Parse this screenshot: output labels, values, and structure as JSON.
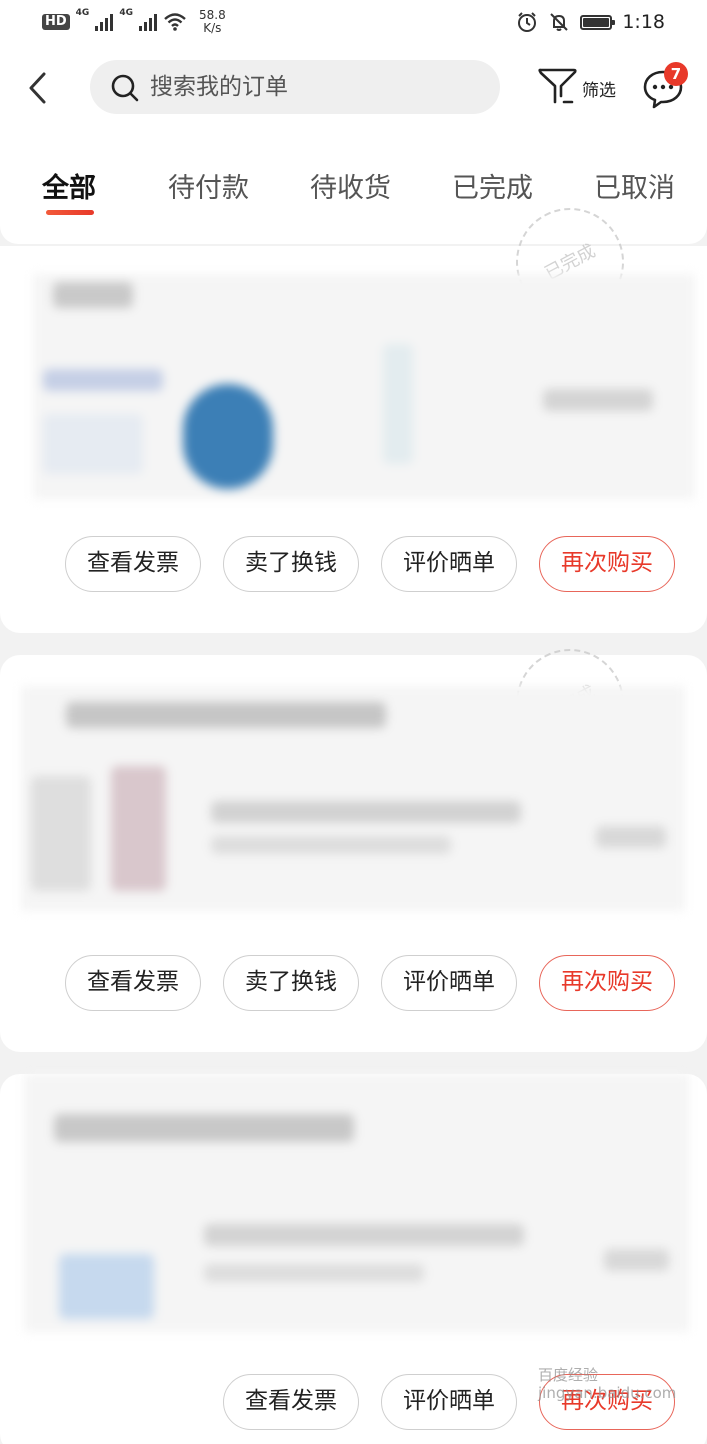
{
  "status_bar": {
    "hd": "HD",
    "net1": "4G",
    "net2": "4G",
    "speed_value": "58.8",
    "speed_unit": "K/s",
    "time": "1:18"
  },
  "header": {
    "search_placeholder": "搜索我的订单",
    "filter_label": "筛选",
    "message_badge": "7"
  },
  "tabs": [
    {
      "label": "全部",
      "active": true
    },
    {
      "label": "待付款",
      "active": false
    },
    {
      "label": "待收货",
      "active": false
    },
    {
      "label": "已完成",
      "active": false
    },
    {
      "label": "已取消",
      "active": false
    }
  ],
  "orders": [
    {
      "stamp": "已完成",
      "actions": [
        "查看发票",
        "卖了换钱",
        "评价晒单",
        "再次购买"
      ]
    },
    {
      "stamp": "已完成",
      "actions": [
        "查看发票",
        "卖了换钱",
        "评价晒单",
        "再次购买"
      ]
    },
    {
      "actions": [
        "查看发票",
        "评价晒单",
        "再次购买"
      ]
    }
  ],
  "watermark": {
    "line1": "百度经验",
    "line2": "jingyan.baidu.com"
  },
  "colors": {
    "accent": "#e8392a",
    "background": "#f2f2f2",
    "card": "#ffffff"
  },
  "icons": [
    "back-arrow-icon",
    "search-icon",
    "filter-icon",
    "message-icon",
    "alarm-icon",
    "mute-icon",
    "battery-icon",
    "wifi-icon",
    "signal-icon"
  ]
}
